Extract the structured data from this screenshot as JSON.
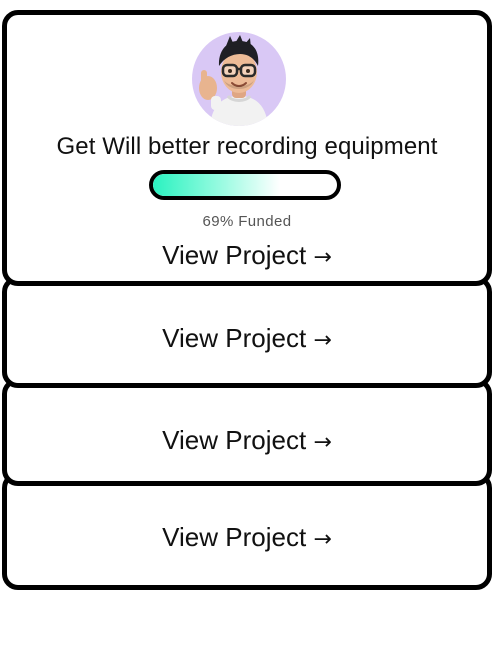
{
  "projects": [
    {
      "title": "Get Will better recording equipment",
      "funded_percent": 69,
      "funded_label": "69% Funded",
      "link_label": "View Project",
      "avatar_icon": "memoji-avatar-icon"
    },
    {
      "link_label": "View Project"
    },
    {
      "link_label": "View Project"
    },
    {
      "link_label": "View Project"
    }
  ],
  "icons": {
    "link_arrow": "→"
  },
  "colors": {
    "avatar_bg": "#d9c8f5",
    "progress_fill": "#2af2c0",
    "border": "#000000"
  }
}
